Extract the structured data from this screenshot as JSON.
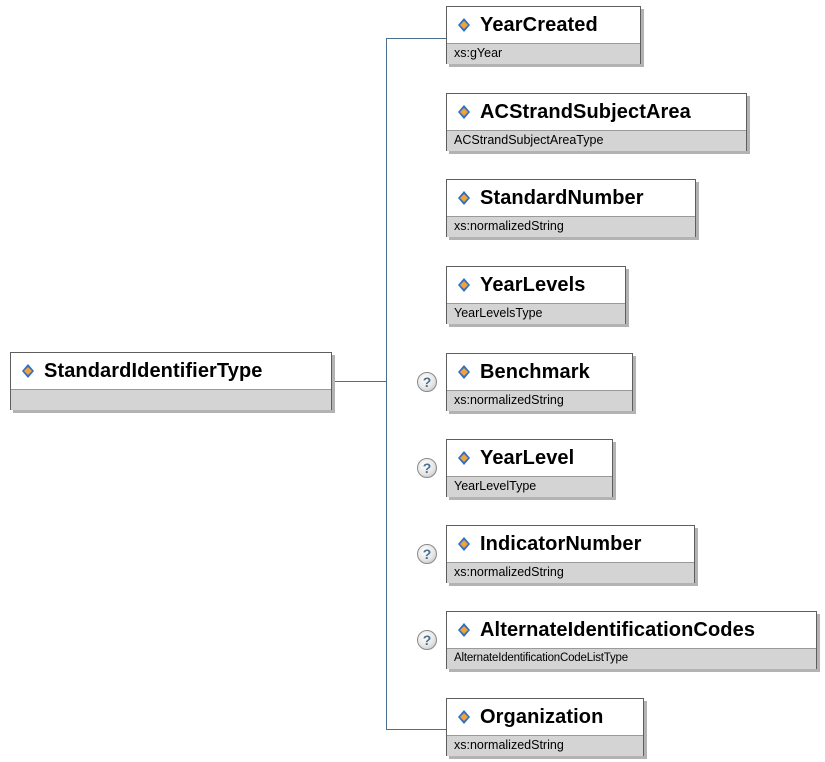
{
  "root": {
    "name": "StandardIdentifierType",
    "type": ""
  },
  "children": [
    {
      "name": "YearCreated",
      "type": "xs:gYear",
      "optional": false
    },
    {
      "name": "ACStrandSubjectArea",
      "type": "ACStrandSubjectAreaType",
      "optional": false
    },
    {
      "name": "StandardNumber",
      "type": "xs:normalizedString",
      "optional": false
    },
    {
      "name": "YearLevels",
      "type": "YearLevelsType",
      "optional": false
    },
    {
      "name": "Benchmark",
      "type": "xs:normalizedString",
      "optional": true
    },
    {
      "name": "YearLevel",
      "type": "YearLevelType",
      "optional": true
    },
    {
      "name": "IndicatorNumber",
      "type": "xs:normalizedString",
      "optional": true
    },
    {
      "name": "AlternateIdentificationCodes",
      "type": "AlternateIdentificationCodeListType",
      "optional": true
    },
    {
      "name": "Organization",
      "type": "xs:normalizedString",
      "optional": false
    }
  ],
  "optional_marker": "?",
  "colors": {
    "connector": "#4a6f8f",
    "type_bar": "#d4d4d4",
    "icon_blue": "#2f6fc4",
    "icon_orange": "#f2a23a"
  }
}
